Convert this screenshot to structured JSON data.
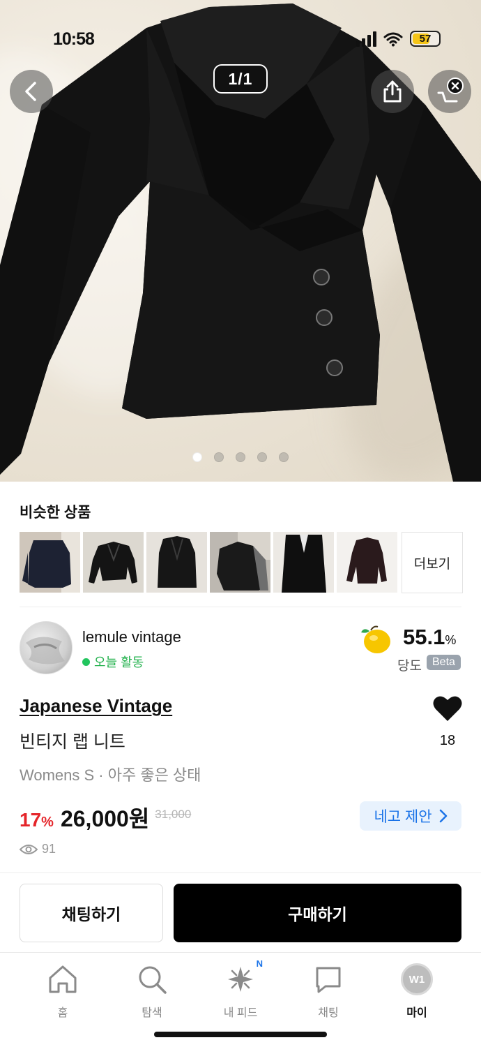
{
  "status_bar": {
    "time": "10:58",
    "battery": "57"
  },
  "gallery": {
    "counter": "1/1",
    "dots": [
      true,
      false,
      false,
      false,
      false
    ]
  },
  "icons": {
    "back": "chevron-left-icon",
    "share": "share-icon",
    "cart": "close-icon",
    "heart": "heart-icon",
    "eye": "eye-icon",
    "chevron": "chevron-right-icon"
  },
  "similar": {
    "title": "비슷한 상품",
    "more_label": "더보기"
  },
  "seller": {
    "name": "lemule vintage",
    "activity": "오늘 활동",
    "sweetness_value": "55.1",
    "sweetness_unit": "%",
    "sweetness_label": "당도",
    "beta_label": "Beta"
  },
  "product": {
    "brand": "Japanese Vintage",
    "name": "빈티지 랩 니트",
    "spec": "Womens S · 아주 좋은 상태",
    "likes": "18",
    "discount_value": "17",
    "discount_unit": "%",
    "price": "26,000원",
    "original_price": "31,000",
    "offer_label": "네고 제안",
    "views": "91"
  },
  "actions": {
    "chat_label": "채팅하기",
    "buy_label": "구매하기"
  },
  "tabs": [
    {
      "label": "홈"
    },
    {
      "label": "탐색"
    },
    {
      "label": "내 피드",
      "badge": "N"
    },
    {
      "label": "채팅"
    },
    {
      "label": "마이",
      "avatar_text": "W1"
    }
  ],
  "colors": {
    "discount_red": "#e5252a",
    "active_green": "#22c55e",
    "offer_blue": "#1a73e8",
    "offer_bg": "#e8f2fd",
    "buy_button_bg": "#000000"
  }
}
